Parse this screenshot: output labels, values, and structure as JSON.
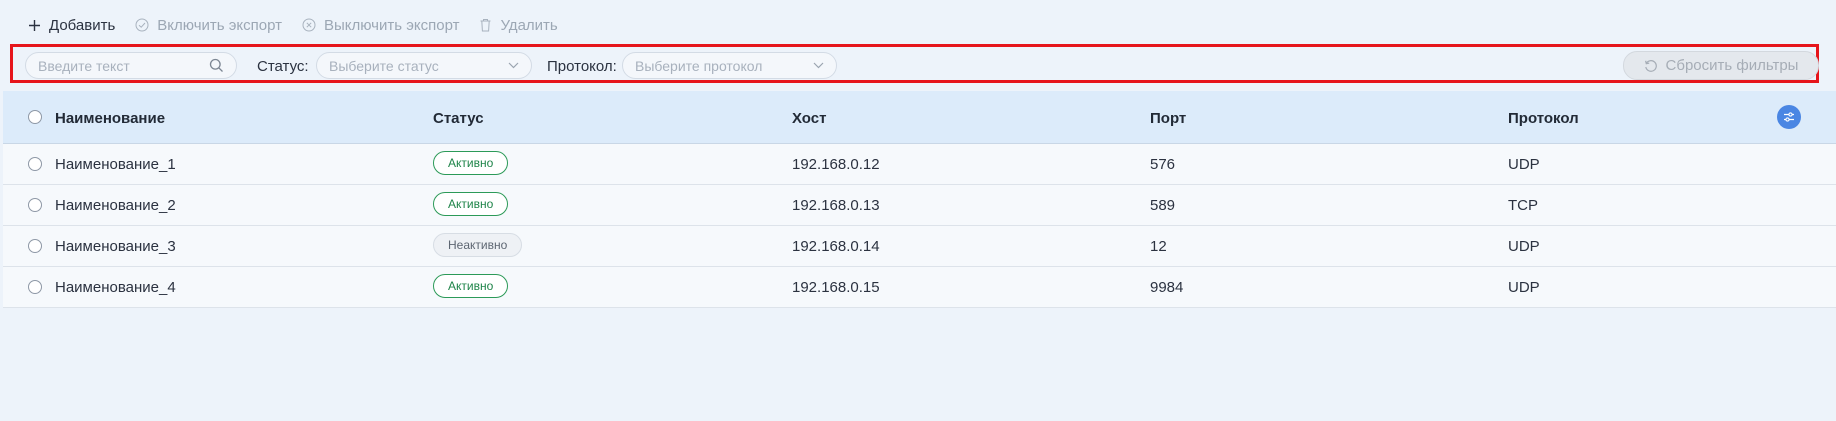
{
  "toolbar": {
    "add_label": "Добавить",
    "enable_export_label": "Включить экспорт",
    "disable_export_label": "Выключить экспорт",
    "delete_label": "Удалить"
  },
  "filters": {
    "search_placeholder": "Введите текст",
    "status_label": "Статус:",
    "status_placeholder": "Выберите статус",
    "protocol_label": "Протокол:",
    "protocol_placeholder": "Выберите протокол",
    "reset_label": "Сбросить фильтры",
    "highlight_color": "#e6151b"
  },
  "table": {
    "columns": [
      "Наименование",
      "Статус",
      "Хост",
      "Порт",
      "Протокол"
    ],
    "rows": [
      {
        "name": "Наименование_1",
        "status": "Активно",
        "status_type": "active",
        "host": "192.168.0.12",
        "port": "576",
        "protocol": "UDP"
      },
      {
        "name": "Наименование_2",
        "status": "Активно",
        "status_type": "active",
        "host": "192.168.0.13",
        "port": "589",
        "protocol": "TCP"
      },
      {
        "name": "Наименование_3",
        "status": "Неактивно",
        "status_type": "inactive",
        "host": "192.168.0.14",
        "port": "12",
        "protocol": "UDP"
      },
      {
        "name": "Наименование_4",
        "status": "Активно",
        "status_type": "active",
        "host": "192.168.0.15",
        "port": "9984",
        "protocol": "UDP"
      }
    ]
  },
  "colors": {
    "accent": "#4a86e3",
    "active_badge": "#2c9a58",
    "header_bg": "#dcebfa"
  },
  "icons": {
    "add": "plus-icon",
    "enable_export": "check-circle-icon",
    "disable_export": "x-circle-icon",
    "delete": "trash-icon",
    "search": "search-icon",
    "dropdown": "chevron-down-icon",
    "reset": "refresh-icon",
    "column_settings": "sliders-icon"
  }
}
